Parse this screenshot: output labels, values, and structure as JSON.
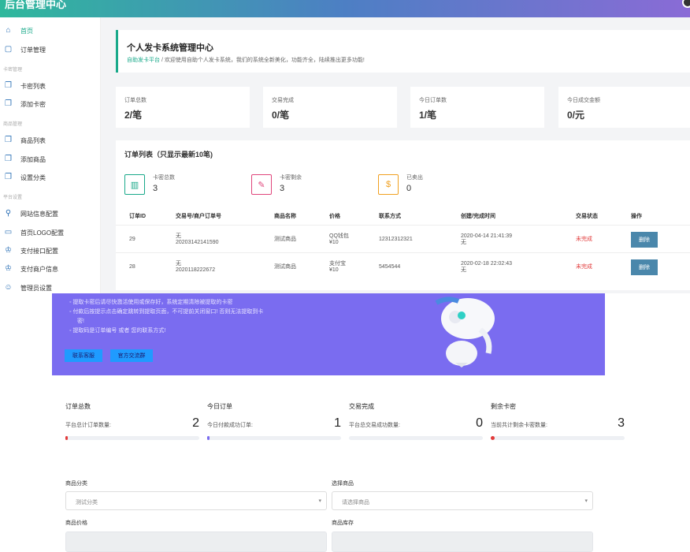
{
  "app": {
    "brand": "后台管理中心"
  },
  "sidebar": {
    "items": [
      {
        "label": "首页",
        "icon": "home-icon",
        "glyph": "⌂"
      },
      {
        "label": "订单管理",
        "icon": "order-icon",
        "glyph": "▢"
      },
      {
        "label": "卡密列表",
        "icon": "card-list-icon",
        "glyph": "❐"
      },
      {
        "label": "添加卡密",
        "icon": "add-card-icon",
        "glyph": "❐"
      },
      {
        "label": "商品列表",
        "icon": "product-list-icon",
        "glyph": "❐"
      },
      {
        "label": "添加商品",
        "icon": "add-product-icon",
        "glyph": "❐"
      },
      {
        "label": "设置分类",
        "icon": "category-icon",
        "glyph": "❐"
      },
      {
        "label": "网站信息配置",
        "icon": "site-config-icon",
        "glyph": "⚲"
      },
      {
        "label": "首页LOGO配置",
        "icon": "logo-config-icon",
        "glyph": "▭"
      },
      {
        "label": "支付接口配置",
        "icon": "payment-config-icon",
        "glyph": "♔"
      },
      {
        "label": "支付商户信息",
        "icon": "merchant-icon",
        "glyph": "♔"
      },
      {
        "label": "管理员设置",
        "icon": "admin-icon",
        "glyph": "☺"
      }
    ],
    "sections": [
      "卡密管理",
      "商品管理",
      "平台设置"
    ]
  },
  "header": {
    "title": "个人发卡系统管理中心",
    "breadcrumb_link": "自助发卡平台",
    "separator": "/",
    "welcome": "欢迎使用自助个人发卡系统，我们的系统全新美化，功能齐全，陆续推出更多功能!"
  },
  "stats": [
    {
      "label": "订单总数",
      "value": "2/笔"
    },
    {
      "label": "交易完成",
      "value": "0/笔"
    },
    {
      "label": "今日订单数",
      "value": "1/笔"
    },
    {
      "label": "今日成交金额",
      "value": "0/元"
    }
  ],
  "order_list": {
    "title": "订单列表（只显示最新10笔)",
    "mini_stats": [
      {
        "label": "卡密总数",
        "value": "3",
        "icon": "bar-chart-icon",
        "glyph": "▥",
        "color": "#19a98a"
      },
      {
        "label": "卡密剩余",
        "value": "3",
        "icon": "ticket-icon",
        "glyph": "✎",
        "color": "#e0457b"
      },
      {
        "label": "已卖出",
        "value": "0",
        "icon": "dollar-icon",
        "glyph": "$",
        "color": "#f0a020"
      }
    ],
    "columns": [
      "订单ID",
      "交易号/商户订单号",
      "商品名称",
      "价格",
      "联系方式",
      "创建/完成时间",
      "交易状态",
      "操作"
    ],
    "rows": [
      {
        "id": "29",
        "trade_no": "无",
        "order_no": "20203142141590",
        "product": "测试商品",
        "pay": "QQ钱包",
        "price": "¥10",
        "contact": "12312312321",
        "created": "2020-04-14 21:41:39",
        "finished": "无",
        "status": "未完成",
        "action": "删除"
      },
      {
        "id": "28",
        "trade_no": "无",
        "order_no": "20201182226​72",
        "product": "测试商品",
        "pay": "支付宝",
        "price": "¥10",
        "contact": "5454544",
        "created": "2020-02-18 22:02:43",
        "finished": "无",
        "status": "未完成",
        "action": "删除"
      }
    ]
  },
  "notice": {
    "lines": [
      "提取卡密后请尽快激活使用或保存好，系统定期清除被提取的卡密",
      "付款后按提示点击确定跳转到提取页面，不可提前关闭窗口! 否则无法提取到卡",
      "密!",
      "提取码是订单编号 或者 您的联系方式!"
    ],
    "buttons": [
      "联系客服",
      "官方交流群"
    ]
  },
  "summary": [
    {
      "title": "订单总数",
      "desc": "平台总计订单数量:",
      "value": "2",
      "progress": 0.02,
      "color": "#e23b3b"
    },
    {
      "title": "今日订单",
      "desc": "今日付款成功订单:",
      "value": "1",
      "progress": 0.01,
      "color": "#7a6cf0"
    },
    {
      "title": "交易完成",
      "desc": "平台总交易成功数量:",
      "value": "0",
      "progress": 0,
      "color": "#19a98a"
    },
    {
      "title": "剩余卡密",
      "desc": "当前共计剩余卡密数量:",
      "value": "3",
      "progress": 0.03,
      "color": "#e23b3b"
    }
  ],
  "form": {
    "category_label": "商品分类",
    "category_value": "测试分类",
    "product_label": "选择商品",
    "product_value": "请选择商品",
    "price_label": "商品价格",
    "stock_label": "商品库存"
  }
}
